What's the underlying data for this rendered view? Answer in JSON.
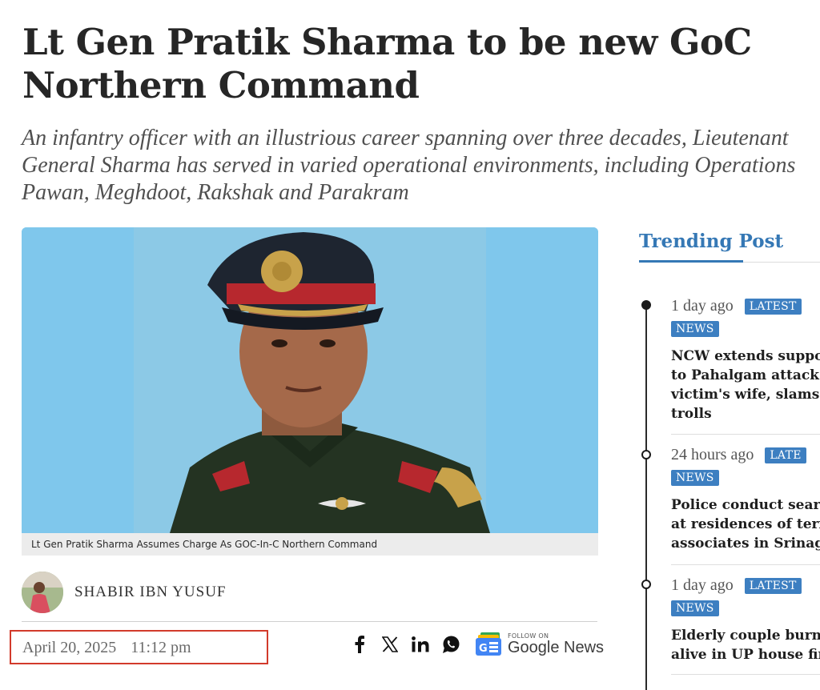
{
  "article": {
    "title_line1": "Lt Gen Pratik Sharma to be new GoC",
    "title_line2": "Northern Command",
    "subtitle_line1": "An infantry officer with an illustrious career spanning over three decades, Lieutenant",
    "subtitle_line2": "General Sharma has served in varied operational environments, including Operations",
    "subtitle_line3": "Pawan, Meghdoot, Rakshak and Parakram",
    "image_caption": "Lt Gen Pratik Sharma Assumes Charge As GOC-In-C Northern Command",
    "author": "SHABIR IBN YUSUF",
    "date": "April 20, 2025",
    "time": "11:12 pm"
  },
  "share": {
    "icons": [
      "facebook-icon",
      "x-icon",
      "linkedin-icon",
      "whatsapp-icon"
    ],
    "google_follow": "FOLLOW ON",
    "google_brand": "Google News"
  },
  "sidebar": {
    "title": "Trending Post",
    "items": [
      {
        "time": "1 day ago",
        "badge1": "LATEST",
        "badge2": "NEWS",
        "headline": [
          "NCW extends suppor",
          "to Pahalgam attack",
          "victim's wife, slams h",
          "trolls"
        ]
      },
      {
        "time": "24 hours ago",
        "badge1": "LATE",
        "badge2": "NEWS",
        "headline": [
          "Police conduct search",
          "at residences of terro",
          "associates in Srinaga"
        ]
      },
      {
        "time": "1 day ago",
        "badge1": "LATEST",
        "badge2": "NEWS",
        "headline": [
          "Elderly couple burnt",
          "alive in UP house fire"
        ]
      }
    ]
  },
  "colors": {
    "accent": "#3578b5",
    "badge": "#3d7fc1",
    "highlight_border": "#d23a2b",
    "photo_bg": "#7fc7ec"
  }
}
